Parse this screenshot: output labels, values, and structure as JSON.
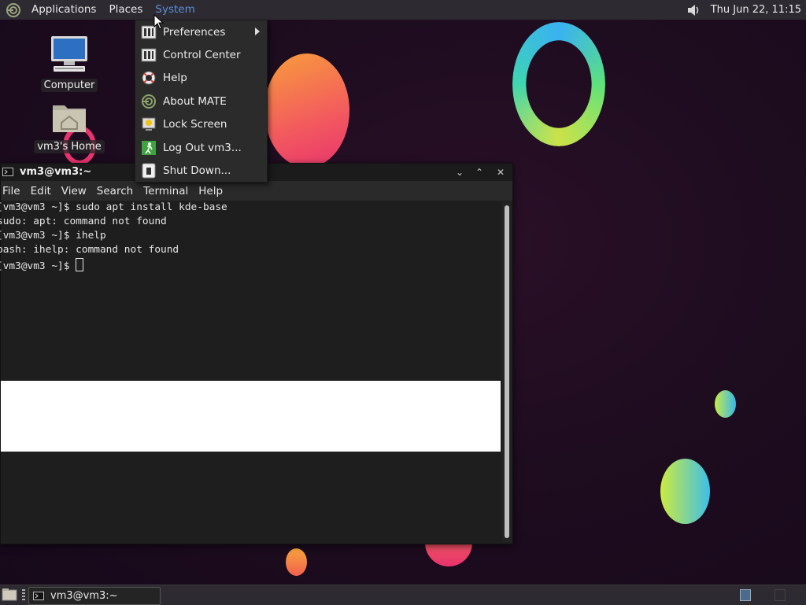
{
  "top_panel": {
    "menus": [
      "Applications",
      "Places",
      "System"
    ],
    "clock": "Thu Jun 22, 11:15",
    "icons": {
      "logo": "mate-logo-icon",
      "volume": "volume-icon"
    }
  },
  "desktop": {
    "icons": [
      {
        "label": "Computer",
        "icon": "computer-icon"
      },
      {
        "label": "vm3's Home",
        "icon": "home-folder-icon"
      }
    ]
  },
  "system_menu": {
    "items": [
      {
        "label": "Preferences",
        "icon": "preferences-icon",
        "submenu": true
      },
      {
        "label": "Control Center",
        "icon": "control-center-icon"
      },
      {
        "label": "Help",
        "icon": "help-icon"
      },
      {
        "label": "About MATE",
        "icon": "about-mate-icon"
      },
      {
        "label": "Lock Screen",
        "icon": "lock-screen-icon"
      },
      {
        "label": "Log Out vm3...",
        "icon": "log-out-icon"
      },
      {
        "label": "Shut Down...",
        "icon": "shut-down-icon"
      }
    ]
  },
  "terminal": {
    "title": "vm3@vm3:~",
    "menu": [
      "File",
      "Edit",
      "View",
      "Search",
      "Terminal",
      "Help"
    ],
    "lines": [
      "[vm3@vm3 ~]$ sudo apt install kde-base",
      "sudo: apt: command not found",
      "[vm3@vm3 ~]$ ihelp",
      "bash: ihelp: command not found",
      "[vm3@vm3 ~]$ "
    ]
  },
  "taskbar": {
    "task_label": "vm3@vm3:~"
  },
  "colors": {
    "panel": "#2e2a31",
    "menu_bg": "#2b2b2b",
    "terminal_bg": "#1e1e1e",
    "active_menu": "#5b8fd9"
  }
}
